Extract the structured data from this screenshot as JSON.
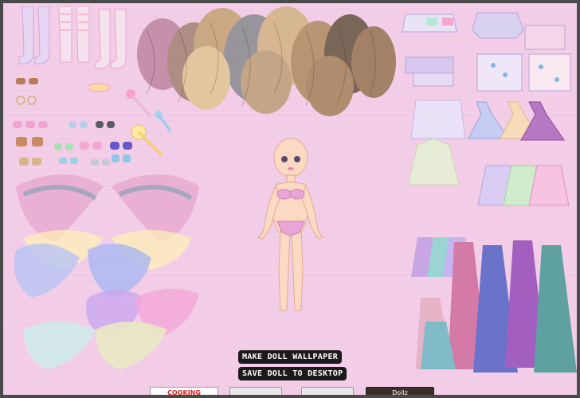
{
  "actions": {
    "make_wallpaper": "MAKE DOLL WALLPAPER",
    "save_desktop": "SAVE DOLL TO DESKTOP"
  },
  "footer": {
    "left_label": "COOKING",
    "right_label": "Dollz"
  },
  "colors": {
    "background": "#f2cbe6",
    "frame": "#4a4a4a",
    "button_bg": "#1e1a1c",
    "skin": "#fbd9c3",
    "bikini": "#e8a6d6"
  }
}
